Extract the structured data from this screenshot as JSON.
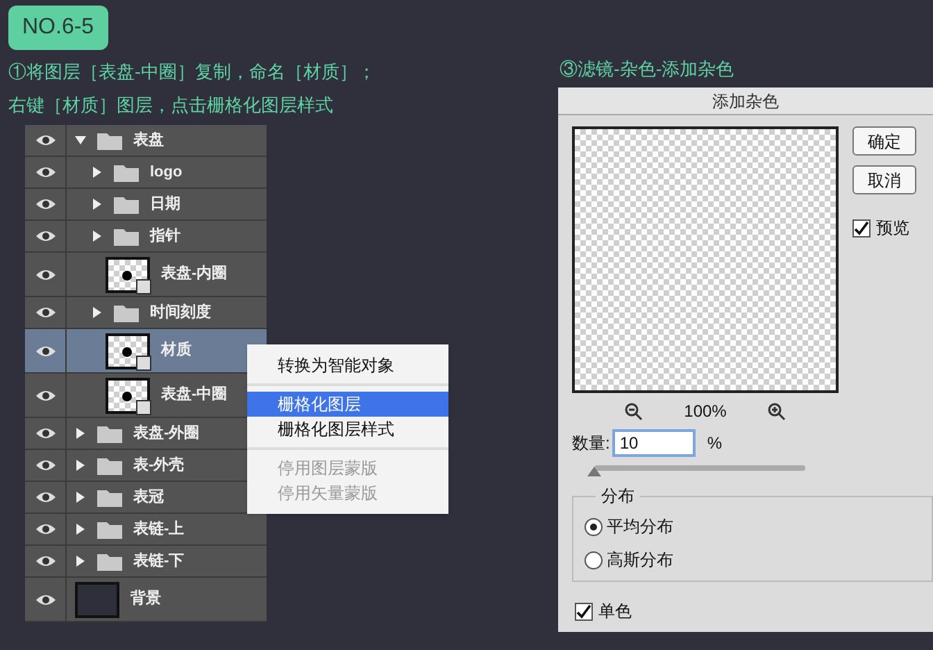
{
  "badge": "NO.6-5",
  "instructions": [
    "①将图层［表盘-中圈］复制，命名［材质］；",
    "右键［材质］图层，点击栅格化图层样式"
  ],
  "layers": [
    {
      "kind": "folder",
      "name": "表盘",
      "expanded": true,
      "selected": false,
      "children": [
        {
          "kind": "folder",
          "name": "logo",
          "expanded": false,
          "selected": false
        },
        {
          "kind": "folder",
          "name": "日期",
          "expanded": false,
          "selected": false
        },
        {
          "kind": "folder",
          "name": "指针",
          "expanded": false,
          "selected": false
        },
        {
          "kind": "layer",
          "name": "表盘-内圈",
          "selected": false
        },
        {
          "kind": "folder",
          "name": "时间刻度",
          "expanded": false,
          "selected": false
        },
        {
          "kind": "layer",
          "name": "材质",
          "selected": true
        },
        {
          "kind": "layer",
          "name": "表盘-中圈",
          "selected": false
        }
      ]
    },
    {
      "kind": "folder",
      "name": "表盘-外圈",
      "expanded": false,
      "selected": false
    },
    {
      "kind": "folder",
      "name": "表-外壳",
      "expanded": false,
      "selected": false
    },
    {
      "kind": "folder",
      "name": "表冠",
      "expanded": false,
      "selected": false
    },
    {
      "kind": "folder",
      "name": "表链-上",
      "expanded": false,
      "selected": false
    },
    {
      "kind": "folder",
      "name": "表链-下",
      "expanded": false,
      "selected": false
    },
    {
      "kind": "background",
      "name": "背景",
      "selected": false
    }
  ],
  "context_menu": [
    [
      {
        "label": "转换为智能对象",
        "selected": false,
        "disabled": false
      }
    ],
    [
      {
        "label": "栅格化图层",
        "selected": true,
        "disabled": false
      },
      {
        "label": "栅格化图层样式",
        "selected": false,
        "disabled": false
      }
    ],
    [
      {
        "label": "停用图层蒙版",
        "selected": false,
        "disabled": true
      },
      {
        "label": "停用矢量蒙版",
        "selected": false,
        "disabled": true
      }
    ]
  ],
  "step_title": "③滤镜-杂色-添加杂色",
  "dialog": {
    "title": "添加杂色",
    "buttons": [
      "确定",
      "取消"
    ],
    "preview": {
      "label": "预览",
      "checked": true
    },
    "zoom": "100%",
    "amount": {
      "label": "数量:",
      "value": "10",
      "unit": "%",
      "level": 0
    },
    "distribution": {
      "title": "分布",
      "options": [
        {
          "label": "平均分布",
          "selected": true
        },
        {
          "label": "高斯分布",
          "selected": false
        }
      ]
    },
    "monochrome": {
      "label": "单色",
      "checked": true
    }
  }
}
